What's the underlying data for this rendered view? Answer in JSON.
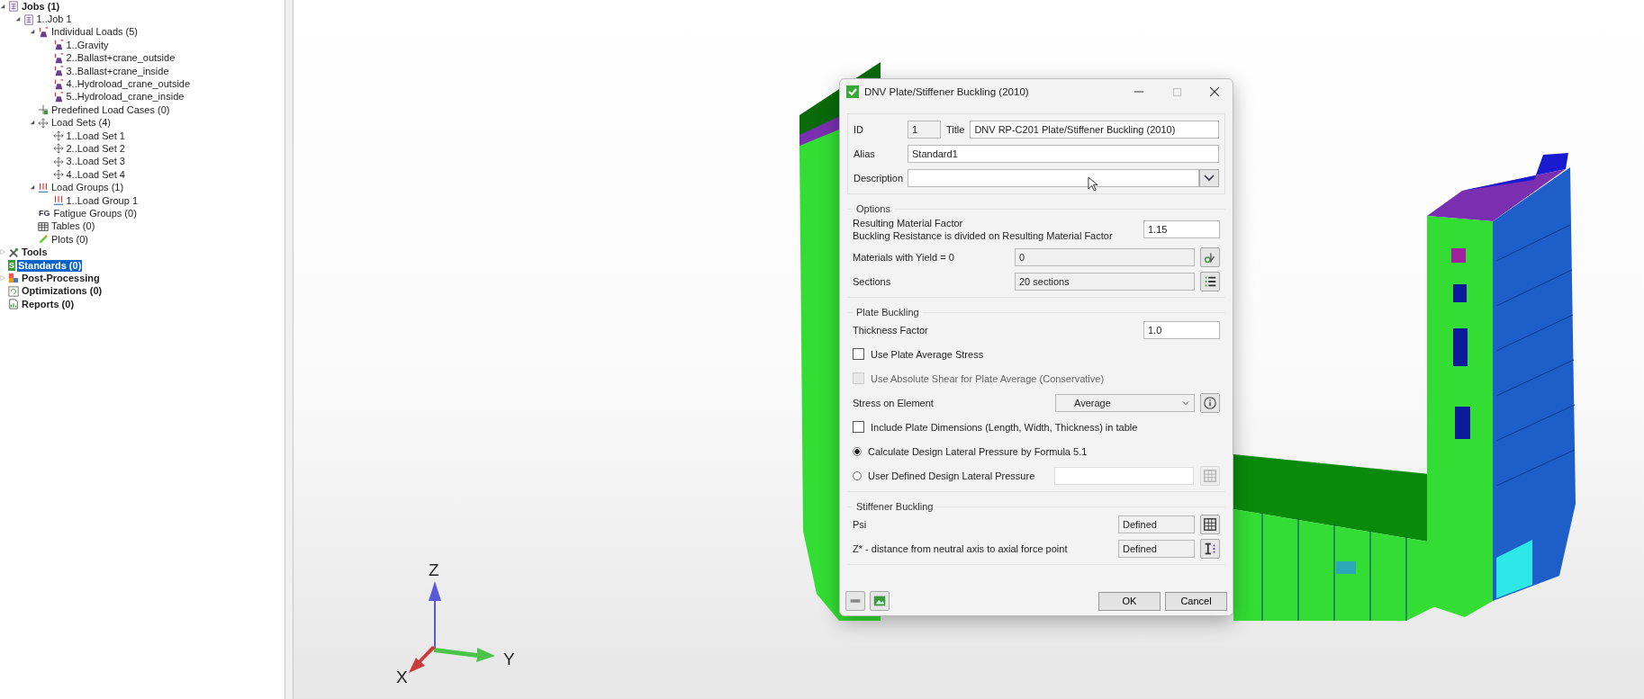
{
  "tree": {
    "items": [
      {
        "label": "Jobs (1)",
        "kind": "job-list",
        "expanded": true,
        "selected": false,
        "children": [
          {
            "label": "1..Job 1",
            "kind": "job",
            "expanded": true,
            "selected": false,
            "children": [
              {
                "label": "Individual Loads (5)",
                "kind": "loads",
                "expanded": true,
                "selected": false,
                "children": [
                  {
                    "label": "1..Gravity",
                    "kind": "load",
                    "selected": false
                  },
                  {
                    "label": "2..Ballast+crane_outside",
                    "kind": "load",
                    "selected": false
                  },
                  {
                    "label": "3..Ballast+crane_inside",
                    "kind": "load",
                    "selected": false
                  },
                  {
                    "label": "4..Hydroload_crane_outside",
                    "kind": "load",
                    "selected": false
                  },
                  {
                    "label": "5..Hydroload_crane_inside",
                    "kind": "load",
                    "selected": false
                  }
                ]
              },
              {
                "label": "Predefined Load Cases (0)",
                "kind": "load-cases",
                "selected": false
              },
              {
                "label": "Load Sets (4)",
                "kind": "load-sets",
                "expanded": true,
                "selected": false,
                "children": [
                  {
                    "label": "1..Load Set 1",
                    "kind": "load-set",
                    "selected": false
                  },
                  {
                    "label": "2..Load Set 2",
                    "kind": "load-set",
                    "selected": false
                  },
                  {
                    "label": "3..Load Set 3",
                    "kind": "load-set",
                    "selected": false
                  },
                  {
                    "label": "4..Load Set 4",
                    "kind": "load-set",
                    "selected": false
                  }
                ]
              },
              {
                "label": "Load Groups (1)",
                "kind": "load-groups",
                "expanded": true,
                "selected": false,
                "children": [
                  {
                    "label": "1..Load Group 1",
                    "kind": "load-group",
                    "selected": false
                  }
                ]
              },
              {
                "label": "Fatigue Groups (0)",
                "kind": "fatigue",
                "icon_text": "FG",
                "selected": false
              },
              {
                "label": "Tables (0)",
                "kind": "tables",
                "selected": false
              },
              {
                "label": "Plots (0)",
                "kind": "plots",
                "selected": false
              }
            ]
          }
        ]
      },
      {
        "label": "Tools",
        "kind": "tools",
        "expanded": false,
        "selected": false
      },
      {
        "label": "Standards (0)",
        "kind": "standards",
        "icon_text": "S",
        "selected": true
      },
      {
        "label": "Post-Processing",
        "kind": "post",
        "expanded": false,
        "selected": false
      },
      {
        "label": "Optimizations (0)",
        "kind": "optimizations",
        "selected": false
      },
      {
        "label": "Reports (0)",
        "kind": "reports",
        "selected": false
      }
    ]
  },
  "viewport": {
    "axes": [
      {
        "kind": "z",
        "label": "Z"
      },
      {
        "kind": "y",
        "label": "Y"
      },
      {
        "kind": "x",
        "label": "X"
      }
    ]
  },
  "dialog": {
    "title": "DNV Plate/Stiffener Buckling (2010)",
    "header": {
      "id_label": "ID",
      "id_value": "1",
      "title_label": "Title",
      "title_value": "DNV RP-C201 Plate/Stiffener Buckling (2010)",
      "alias_label": "Alias",
      "alias_value": "Standard1",
      "description_label": "Description"
    },
    "groups": [
      {
        "heading": "Options",
        "rows": [
          {
            "kind": "value",
            "label": "Resulting Material Factor",
            "note": "Buckling Resistance is divided on Resulting Material Factor",
            "value": "1.15"
          },
          {
            "kind": "picker",
            "label": "Materials with Yield = 0",
            "value": "0",
            "button": {
              "kind": "materials",
              "disabled": false
            }
          },
          {
            "kind": "picker",
            "label": "Sections",
            "value": "20 sections",
            "button": {
              "kind": "list",
              "disabled": false
            }
          }
        ]
      },
      {
        "heading": "Plate Buckling",
        "rows": [
          {
            "kind": "value",
            "label": "Thickness Factor",
            "value": "1.0"
          },
          {
            "kind": "checkbox",
            "label": "Use Plate Average Stress",
            "checked": false,
            "disabled": false
          },
          {
            "kind": "checkbox",
            "label": "Use Absolute Shear for Plate Average (Conservative)",
            "checked": false,
            "disabled": true
          },
          {
            "kind": "select",
            "label": "Stress on Element",
            "value": "Average",
            "button": {
              "kind": "info",
              "disabled": false
            }
          },
          {
            "kind": "checkbox",
            "label": "Include Plate Dimensions (Length, Width, Thickness) in table",
            "checked": false,
            "disabled": false
          },
          {
            "kind": "radio",
            "label": "Calculate Design Lateral Pressure by Formula 5.1",
            "selected": true
          },
          {
            "kind": "radio-field",
            "label": "User Defined Design Lateral Pressure",
            "selected": false,
            "button": {
              "kind": "grid",
              "disabled": true
            }
          }
        ]
      },
      {
        "heading": "Stiffener Buckling",
        "rows": [
          {
            "kind": "defined",
            "label": "Psi",
            "value": "Defined",
            "button": {
              "kind": "grid",
              "disabled": false
            }
          },
          {
            "kind": "defined",
            "label": "Z* - distance from neutral axis to axial force point",
            "value": "Defined",
            "button": {
              "kind": "beam",
              "disabled": false
            }
          }
        ]
      }
    ],
    "footer": {
      "tool_buttons": [
        {
          "kind": "panel"
        },
        {
          "kind": "image"
        }
      ],
      "buttons": [
        "OK",
        "Cancel"
      ]
    }
  }
}
